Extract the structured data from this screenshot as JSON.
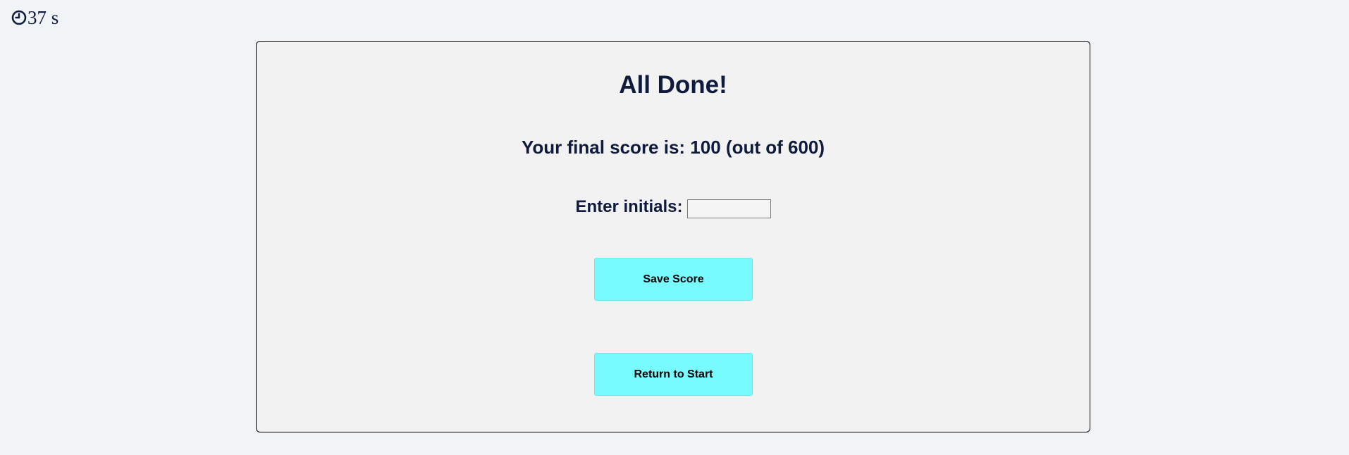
{
  "timer": {
    "icon": "clock-icon",
    "value": "37 s"
  },
  "results": {
    "title": "All Done!",
    "score_text": "Your final score is: 100 (out of 600)",
    "initials_label": "Enter initials:",
    "initials_value": "",
    "save_label": "Save Score",
    "return_label": "Return to Start"
  },
  "colors": {
    "background": "#f0f4f7",
    "card_background": "#f2f2f2",
    "text": "#0f1b3d",
    "button": "#77fbff"
  }
}
